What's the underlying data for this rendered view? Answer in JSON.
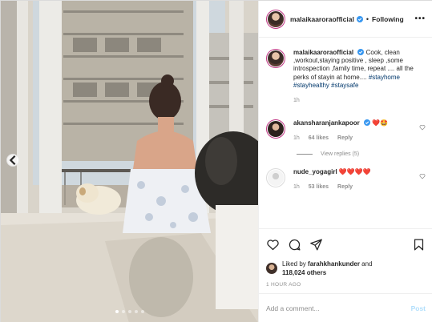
{
  "photo": {
    "alt_subject": "woman seated by a window with a dog and balcony view",
    "carousel_count": 5,
    "carousel_active": 0
  },
  "header": {
    "username": "malaikaaroraofficial",
    "follow_status": "Following",
    "separator": "•",
    "more": "•••"
  },
  "caption": {
    "username": "malaikaaroraofficial",
    "text": "Cook, clean ,workout,staying positive , sleep ,some introspection ,family time, repeat .... all the perks of stayin at home.... ",
    "hashtags": [
      "#stayhome",
      "#stayhealthy",
      "#staysafe"
    ],
    "time": "1h"
  },
  "comments": [
    {
      "username": "akansharanjankapoor",
      "text": "❤️🤩",
      "time": "1h",
      "likes": "64 likes",
      "reply": "Reply"
    },
    {
      "username": "nude_yogagirl",
      "text": "❤️❤️❤️❤️",
      "time": "1h",
      "likes": "53 likes",
      "reply": "Reply"
    }
  ],
  "view_replies": "View replies (5)",
  "likes": {
    "prefix": "Liked by",
    "user": "farahkhankunder",
    "and": "and",
    "count": "118,024 others"
  },
  "time_ago": "1 HOUR AGO",
  "add_comment": {
    "placeholder": "Add a comment...",
    "post_label": "Post"
  },
  "colors": {
    "accent_link": "#00376b",
    "verified": "#3897f0",
    "muted": "#8e8e8e",
    "post_disabled": "#b2dffc",
    "heart": "#ed4956"
  }
}
